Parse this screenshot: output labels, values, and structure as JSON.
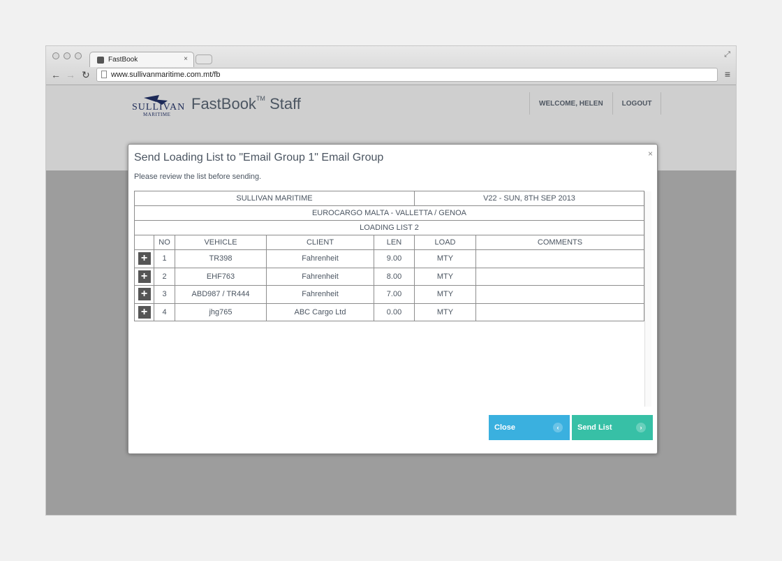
{
  "browser": {
    "tab_title": "FastBook",
    "url": "www.sullivanmaritime.com.mt/fb"
  },
  "header": {
    "logo_top": "SULLIVAN",
    "logo_bottom": "MARITIME",
    "brand": "FastBook",
    "brand_tm": "TM",
    "brand_suffix": "Staff",
    "welcome": "WELCOME, HELEN",
    "logout": "LOGOUT"
  },
  "modal": {
    "title": "Send Loading List to \"Email Group 1\" Email Group",
    "subtitle": "Please review the list before sending.",
    "close_x": "×",
    "company": "SULLIVAN MARITIME",
    "voyage": "V22 - SUN, 8TH SEP 2013",
    "route": "EUROCARGO MALTA - VALLETTA / GENOA",
    "list_name": "LOADING LIST 2",
    "columns": [
      "NO",
      "VEHICLE",
      "CLIENT",
      "LEN",
      "LOAD",
      "COMMENTS"
    ],
    "rows": [
      {
        "no": "1",
        "vehicle": "TR398",
        "client": "Fahrenheit",
        "len": "9.00",
        "load": "MTY",
        "comments": ""
      },
      {
        "no": "2",
        "vehicle": "EHF763",
        "client": "Fahrenheit",
        "len": "8.00",
        "load": "MTY",
        "comments": ""
      },
      {
        "no": "3",
        "vehicle": "ABD987 / TR444",
        "client": "Fahrenheit",
        "len": "7.00",
        "load": "MTY",
        "comments": ""
      },
      {
        "no": "4",
        "vehicle": "jhg765",
        "client": "ABC Cargo Ltd",
        "len": "0.00",
        "load": "MTY",
        "comments": ""
      }
    ],
    "close_button": "Close",
    "send_button": "Send List"
  },
  "colors": {
    "close_button": "#3ab0df",
    "send_button": "#37c0a6",
    "text": "#4b5561"
  }
}
